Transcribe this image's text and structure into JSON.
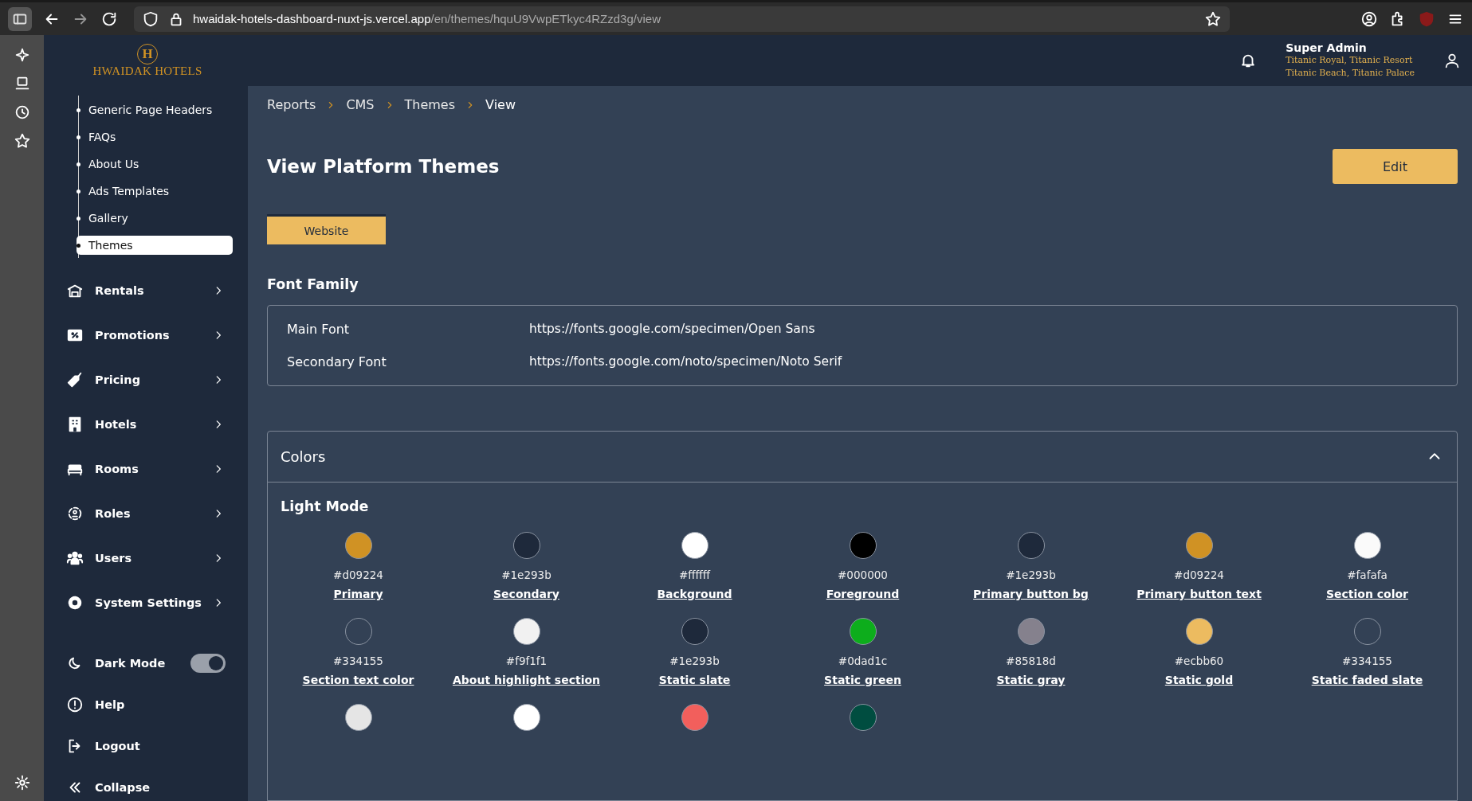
{
  "browser": {
    "url_host": "hwaidak-hotels-dashboard-nuxt-js.vercel.app",
    "url_path": "/en/themes/hquU9VwpETkyc4RZzd3g/view"
  },
  "header": {
    "logo_text": "HWAIDAK HOTELS",
    "logo_letter": "H",
    "user_name": "Super Admin",
    "properties": [
      "Titanic Royal, Titanic Resort",
      "Titanic Beach, Titanic Palace"
    ]
  },
  "sidebar": {
    "sub_items": [
      {
        "label": "Generic Page Headers",
        "selected": false
      },
      {
        "label": "FAQs",
        "selected": false
      },
      {
        "label": "About Us",
        "selected": false
      },
      {
        "label": "Ads Templates",
        "selected": false
      },
      {
        "label": "Gallery",
        "selected": false
      },
      {
        "label": "Themes",
        "selected": true
      }
    ],
    "nav": [
      {
        "label": "Rentals"
      },
      {
        "label": "Promotions"
      },
      {
        "label": "Pricing"
      },
      {
        "label": "Hotels"
      },
      {
        "label": "Rooms"
      },
      {
        "label": "Roles"
      },
      {
        "label": "Users"
      },
      {
        "label": "System Settings"
      }
    ],
    "dark_mode": {
      "label": "Dark Mode",
      "on": true
    },
    "footer": [
      {
        "label": "Help"
      },
      {
        "label": "Logout"
      },
      {
        "label": "Collapse"
      }
    ]
  },
  "breadcrumb": [
    "Reports",
    "CMS",
    "Themes",
    "View"
  ],
  "title": "View Platform Themes",
  "edit_button": "Edit",
  "tabs": [
    {
      "label": "Website",
      "selected": true
    }
  ],
  "font_family": {
    "title": "Font Family",
    "rows": [
      {
        "label": "Main Font",
        "value": "https://fonts.google.com/specimen/Open Sans"
      },
      {
        "label": "Secondary Font",
        "value": "https://fonts.google.com/noto/specimen/Noto Serif"
      }
    ]
  },
  "colors": {
    "title": "Colors",
    "expanded": true,
    "mode_title": "Light Mode",
    "swatches": [
      {
        "color": "#d09224",
        "hex": "#d09224",
        "label": "Primary"
      },
      {
        "color": "#1e293b",
        "hex": "#1e293b",
        "label": "Secondary"
      },
      {
        "color": "#ffffff",
        "hex": "#ffffff",
        "label": "Background"
      },
      {
        "color": "#000000",
        "hex": "#000000",
        "label": "Foreground"
      },
      {
        "color": "#1e293b",
        "hex": "#1e293b",
        "label": "Primary button bg"
      },
      {
        "color": "#d09224",
        "hex": "#d09224",
        "label": "Primary button text"
      },
      {
        "color": "#fafafa",
        "hex": "#fafafa",
        "label": "Section color"
      },
      {
        "color": "#334155",
        "hex": "#334155",
        "label": "Section text color"
      },
      {
        "color": "#f1f1f1",
        "hex": "#f9f1f1",
        "label": "About highlight section"
      },
      {
        "color": "#1e293b",
        "hex": "#1e293b",
        "label": "Static slate"
      },
      {
        "color": "#0dad1c",
        "hex": "#0dad1c",
        "label": "Static green"
      },
      {
        "color": "#85818d",
        "hex": "#85818d",
        "label": "Static gray"
      },
      {
        "color": "#ecbb60",
        "hex": "#ecbb60",
        "label": "Static gold"
      },
      {
        "color": "#334155",
        "hex": "#334155",
        "label": "Static faded slate"
      },
      {
        "color": "#e5e5e5"
      },
      {
        "color": "#ffffff"
      },
      {
        "color": "#f25f5c"
      },
      {
        "color": "#004d40"
      }
    ]
  }
}
